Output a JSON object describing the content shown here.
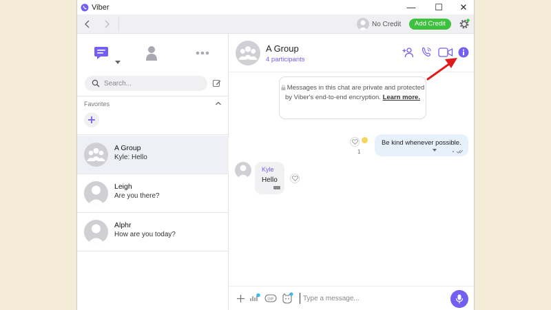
{
  "window": {
    "title": "Viber",
    "minimize": "—",
    "maximize": "☐",
    "close": "✕"
  },
  "toolbar": {
    "credit_text": "No Credit",
    "add_credit_label": "Add Credit"
  },
  "sidebar": {
    "search_placeholder": "Search...",
    "favorites_label": "Favorites",
    "chats": [
      {
        "name": "A Group",
        "preview": "Kyle: Hello",
        "active": true
      },
      {
        "name": "Leigh",
        "preview": "Are you there?",
        "active": false
      },
      {
        "name": "Alphr",
        "preview": "How are you today?",
        "active": false
      }
    ]
  },
  "conversation": {
    "title": "A Group",
    "subtitle": "4 participants",
    "privacy_notice": "Messages in this chat are private and protected by Viber's end-to-end encryption.",
    "learn_more": "Learn more.",
    "messages": [
      {
        "direction": "out",
        "text": "Be kind whenever possible.",
        "like_count": "1"
      },
      {
        "direction": "in",
        "sender": "Kyle",
        "text": "Hello"
      }
    ],
    "composer_placeholder": "Type a message..."
  },
  "colors": {
    "accent": "#7360f2",
    "add_credit": "#3ec13e",
    "annotation_arrow": "#e01a1a"
  }
}
